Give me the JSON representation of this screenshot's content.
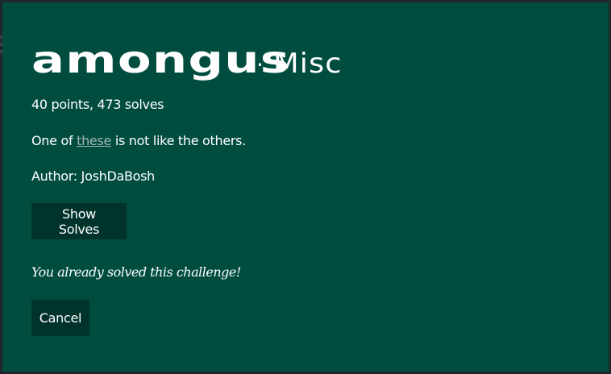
{
  "challenge": {
    "name": "amongus",
    "separator": "·",
    "category": "Misc",
    "points_text": "40 points, 473 solves",
    "description_prefix": "One of",
    "description_link": "these",
    "description_suffix": " is not like the others.",
    "author_text": "Author: JoshDaBosh"
  },
  "buttons": {
    "show_solves": "Show Solves",
    "cancel": "Cancel"
  },
  "status": {
    "solved_message": "You already solved this challenge!"
  },
  "colors": {
    "modal_bg": "#004d40",
    "button_bg": "#00332b",
    "link": "#9fb5ae",
    "text": "#ffffff"
  },
  "icons": {
    "backdrop": "menu-icon"
  }
}
